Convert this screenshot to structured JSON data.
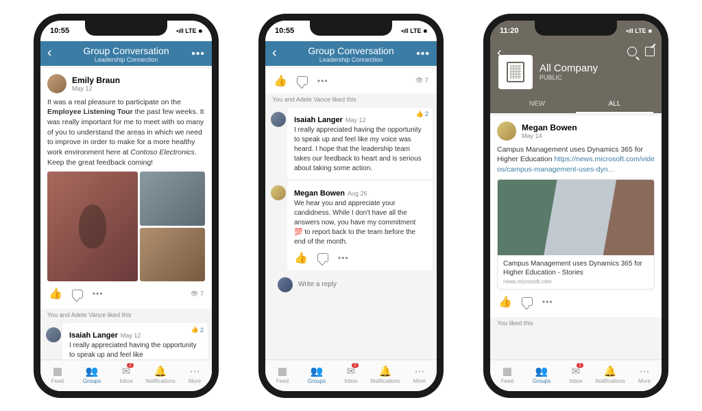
{
  "status": {
    "time": "10:55",
    "time3": "11:20",
    "signal": "•ıll LTE",
    "battery": "■"
  },
  "nav": {
    "title": "Group Conversation",
    "subtitle": "Leadership Connection"
  },
  "post1": {
    "author": "Emily Braun",
    "date": "May 12",
    "body_pre": "It was a real pleasure to participate on the ",
    "body_bold": "Employee Listening Tour",
    "body_mid": " the past few weeks. It was really important for me to meet with so many of you to understand the areas in which we need to improve in order to make for a more healthy work environment here at ",
    "body_italic": "Contoso Electronics",
    "body_post": ". Keep the great feedback coming!",
    "views": "7",
    "liked_by": "You and Adele Vance liked this"
  },
  "reply1": {
    "author": "Isaiah Langer",
    "date": "May 12",
    "body": "I really appreciated having the opportunity to speak up and feel like my voice was heard. I hope that the leadership team takes our feedback to heart and is serious about taking some action.",
    "likes": "2",
    "body_preview": "I really appreciated having the opportunity to speak up and feel like"
  },
  "reply2": {
    "author": "Megan Bowen",
    "date": "Aug 26",
    "body": "We hear you and appreciate your candidness. While I don't have all the answers now, you have my commitment 💯 to report back to the team before the end of the month."
  },
  "reply_input": {
    "placeholder": "Write a reply"
  },
  "phone3": {
    "group_name": "All Company",
    "group_sub": "PUBLIC",
    "tabs": {
      "new": "NEW",
      "all": "ALL"
    },
    "post": {
      "author": "Megan Bowen",
      "date": "May 14",
      "body": "Campus Management uses Dynamics 365 for Higher Education ",
      "link": "https://news.microsoft.com/videos/campus-management-uses-dyn…",
      "preview_title": "Campus Management uses Dynamics 365 for Higher Education - Stories",
      "preview_domain": "news.microsoft.com"
    },
    "liked_by": "You liked this"
  },
  "tabs": {
    "feed": "Feed",
    "groups": "Groups",
    "inbox": "Inbox",
    "notifications": "Notifications",
    "more": "More",
    "inbox_badge": "2"
  }
}
